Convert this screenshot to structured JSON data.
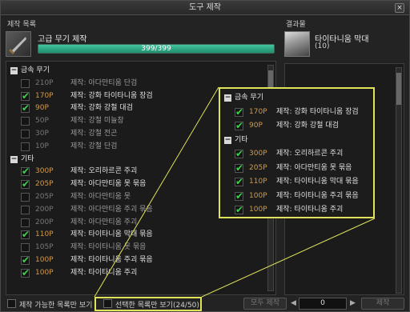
{
  "window": {
    "title": "도구 제작",
    "close": "×"
  },
  "left_section_label": "제작 목록",
  "right_section_label": "결과물",
  "craft": {
    "name": "고급 무기 제작",
    "progress_text": "399/399",
    "progress_fraction": 1.0
  },
  "result": {
    "name": "타이타니움 막대",
    "count": "(10)"
  },
  "list": [
    {
      "type": "group",
      "label": "금속 무기"
    },
    {
      "type": "item",
      "checked": false,
      "points": "210P",
      "name": "제작: 아다만티움 단검"
    },
    {
      "type": "item",
      "checked": true,
      "points": "170P",
      "name": "제작: 강화 타이타니움 장검"
    },
    {
      "type": "item",
      "checked": true,
      "points": "90P",
      "name": "제작: 강화 강철 대검"
    },
    {
      "type": "item",
      "checked": false,
      "points": "50P",
      "name": "제작: 강철 미늘창"
    },
    {
      "type": "item",
      "checked": false,
      "points": "30P",
      "name": "제작: 강철 전곤"
    },
    {
      "type": "item",
      "checked": false,
      "points": "10P",
      "name": "제작: 강철 단검"
    },
    {
      "type": "group",
      "label": "기타"
    },
    {
      "type": "item",
      "checked": true,
      "points": "300P",
      "name": "제작: 오리하르콘 주괴"
    },
    {
      "type": "item",
      "checked": true,
      "points": "205P",
      "name": "제작: 아다만티움 못 묶음"
    },
    {
      "type": "item",
      "checked": false,
      "points": "205P",
      "name": "제작: 아다만티움 못"
    },
    {
      "type": "item",
      "checked": false,
      "points": "200P",
      "name": "제작: 아다만티움 주괴 묶음"
    },
    {
      "type": "item",
      "checked": false,
      "points": "200P",
      "name": "제작: 아다만티움 주괴"
    },
    {
      "type": "item",
      "checked": true,
      "points": "110P",
      "name": "제작: 타이타니움 막대 묶음"
    },
    {
      "type": "item",
      "checked": false,
      "points": "105P",
      "name": "제작: 타이타니움 못 묶음"
    },
    {
      "type": "item",
      "checked": true,
      "points": "100P",
      "name": "제작: 타이타니움 주괴 묶음"
    },
    {
      "type": "item",
      "checked": true,
      "points": "100P",
      "name": "제작: 타이타니움 주괴"
    }
  ],
  "callout": [
    {
      "type": "group",
      "label": "금속 무기"
    },
    {
      "type": "item",
      "checked": true,
      "points": "170P",
      "name": "제작: 강화 타이타니움 장검"
    },
    {
      "type": "item",
      "checked": true,
      "points": "90P",
      "name": "제작: 강화 강철 대검"
    },
    {
      "type": "group",
      "label": "기타"
    },
    {
      "type": "item",
      "checked": true,
      "points": "300P",
      "name": "제작: 오리하르콘 주괴"
    },
    {
      "type": "item",
      "checked": true,
      "points": "205P",
      "name": "제작: 아다만티움 못 묶음"
    },
    {
      "type": "item",
      "checked": true,
      "points": "110P",
      "name": "제작: 타이타니움 막대 묶음"
    },
    {
      "type": "item",
      "checked": true,
      "points": "100P",
      "name": "제작: 타이타니움 주괴 묶음"
    },
    {
      "type": "item",
      "checked": true,
      "points": "100P",
      "name": "제작: 타이타니움 주괴"
    }
  ],
  "footer": {
    "craftable_only": "제작 가능한 목록만 보기",
    "selected_only": "선택한 목록만 보기(24/50)",
    "craft_all": "모두 제작",
    "quantity": "0",
    "craft_btn": "제작"
  },
  "colors": {
    "highlight": "#e0e35a",
    "check": "#3fd24b",
    "points": "#d09a4a",
    "progress": "#2fae88"
  }
}
